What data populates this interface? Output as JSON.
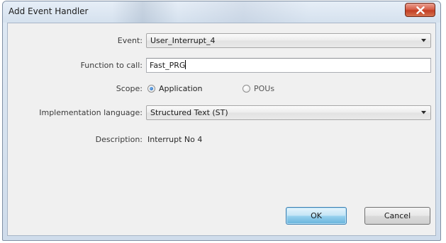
{
  "window": {
    "title": "Add Event Handler"
  },
  "form": {
    "event": {
      "label": "Event:",
      "value": "User_Interrupt_4"
    },
    "function_to_call": {
      "label": "Function to call:",
      "value": "Fast_PRG"
    },
    "scope": {
      "label": "Scope:",
      "options": [
        {
          "label": "Application",
          "selected": true
        },
        {
          "label": "POUs",
          "selected": false
        }
      ]
    },
    "implementation_language": {
      "label": "Implementation language:",
      "value": "Structured Text (ST)"
    },
    "description": {
      "label": "Description:",
      "value": "Interrupt No 4"
    }
  },
  "buttons": {
    "ok_label": "OK",
    "cancel_label": "Cancel"
  },
  "icons": {
    "close": "close-x-icon",
    "dropdown": "chevron-down-icon"
  },
  "colors": {
    "close_button": "#c9452b",
    "default_button": "#98d1ef",
    "radio_selected": "#1e64b4"
  }
}
